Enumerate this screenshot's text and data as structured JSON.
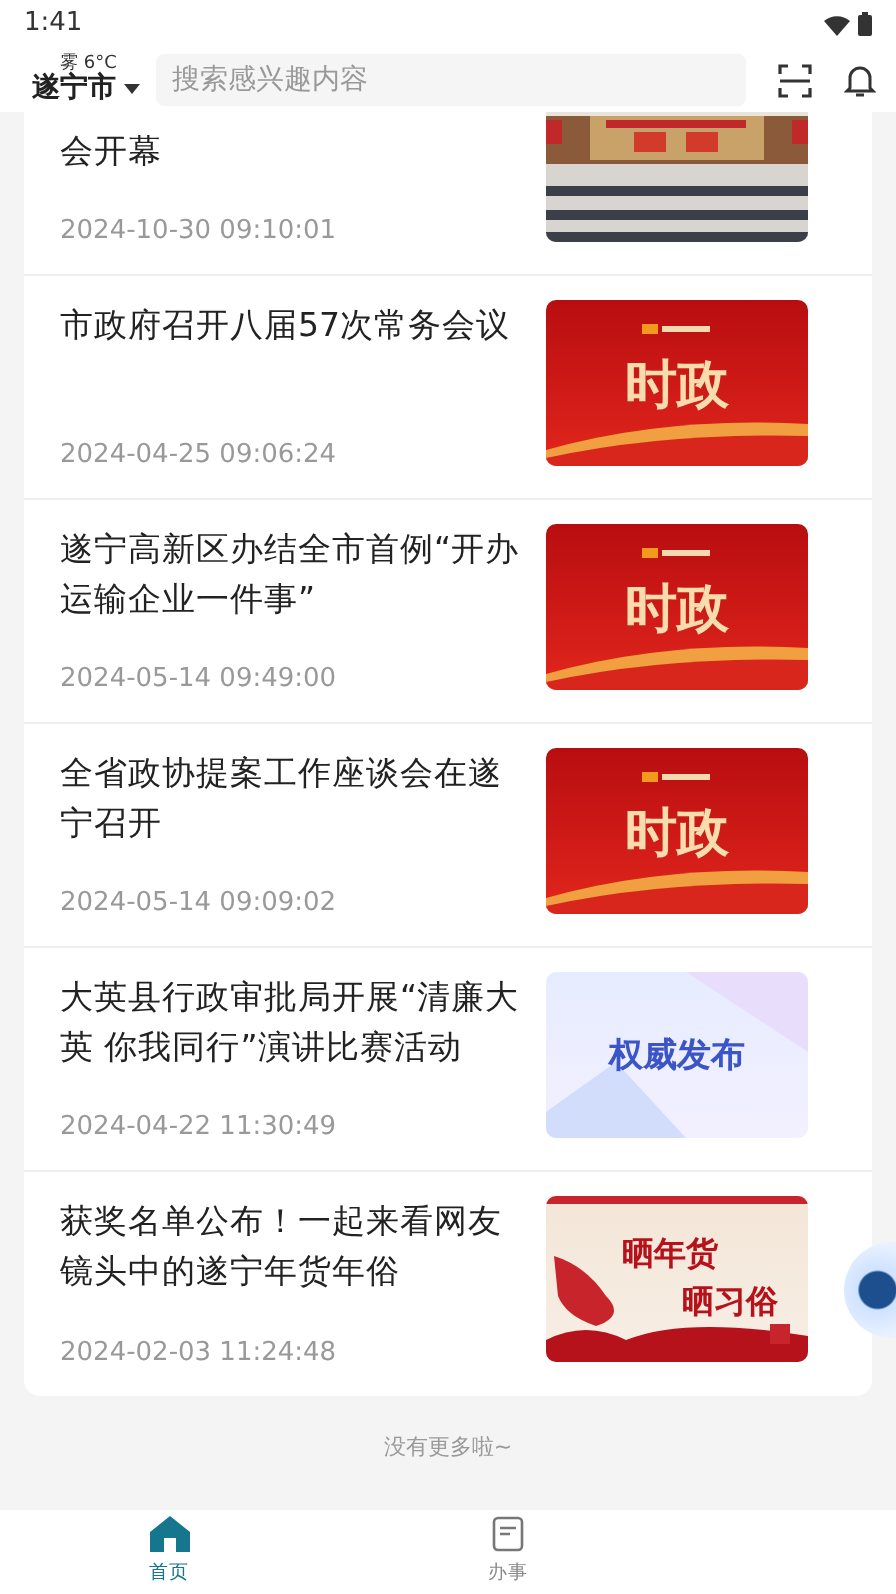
{
  "status_bar": {
    "time": "1:41"
  },
  "header": {
    "weather": "雾 6°C",
    "city": "遂宁市",
    "search": {
      "placeholder": "搜索感兴趣内容"
    }
  },
  "news": [
    {
      "title": "会开幕",
      "date": "2024-10-30 09:10:01"
    },
    {
      "title": "市政府召开八届57次常务会议",
      "date": "2024-04-25 09:06:24",
      "thumb": {
        "kind": "red",
        "text": "时政"
      }
    },
    {
      "title": "遂宁高新区办结全市首例“开办运输企业一件事”",
      "date": "2024-05-14 09:49:00",
      "thumb": {
        "kind": "red",
        "text": "时政"
      }
    },
    {
      "title": "全省政协提案工作座谈会在遂宁召开",
      "date": "2024-05-14 09:09:02",
      "thumb": {
        "kind": "red",
        "text": "时政"
      }
    },
    {
      "title": "大英县行政审批局开展“清廉大英 你我同行”演讲比赛活动",
      "date": "2024-04-22 11:30:49",
      "thumb": {
        "kind": "blue",
        "text": "权威发布"
      }
    },
    {
      "title": "获奖名单公布！一起来看网友镜头中的遂宁年货年俗",
      "date": "2024-02-03 11:24:48",
      "thumb": {
        "kind": "festive",
        "lines": [
          "晒年货",
          "晒习俗"
        ]
      }
    }
  ],
  "end_note": "没有更多啦~",
  "tabs": [
    {
      "label": "首页",
      "selected": true
    },
    {
      "label": "办事",
      "selected": false
    }
  ]
}
